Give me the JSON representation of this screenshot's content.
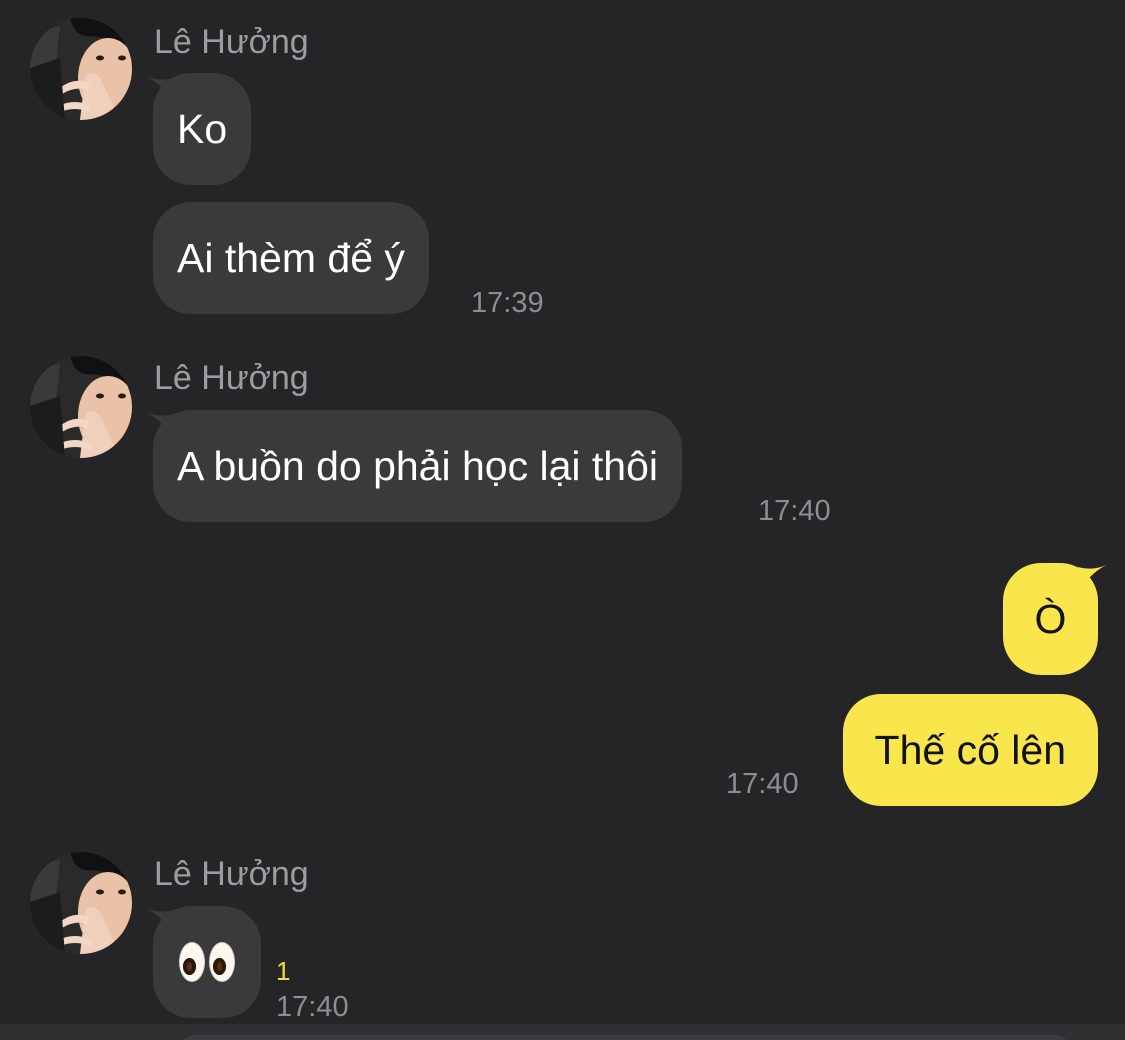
{
  "messages": [
    {
      "sender": "Lê Hưởng",
      "bubbles": [
        "Ko",
        "Ai thèm để ý"
      ],
      "time": "17:39"
    },
    {
      "sender": "Lê Hưởng",
      "bubbles": [
        "A buồn do phải học lại thôi"
      ],
      "time": "17:40"
    },
    {
      "outgoing": true,
      "bubbles": [
        "Ò",
        "Thế cố lên"
      ],
      "time": "17:40"
    },
    {
      "sender": "Lê Hưởng",
      "bubbles": [
        "👀"
      ],
      "unread_count": "1",
      "time": "17:40"
    }
  ],
  "colors": {
    "background": "#252528",
    "incoming_bubble": "#3a3a3d",
    "outgoing_bubble": "#f9e54c",
    "unread_indicator": "#f5da3a",
    "timestamp": "#8e8e92"
  }
}
